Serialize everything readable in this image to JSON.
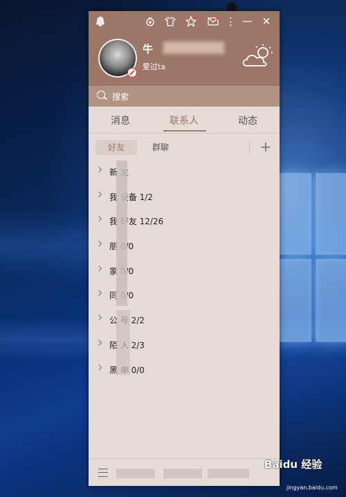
{
  "header": {
    "nickname_visible": "牛",
    "signature": "爱过ta"
  },
  "search": {
    "placeholder": "搜索"
  },
  "tabs": [
    {
      "label": "消息"
    },
    {
      "label": "联系人"
    },
    {
      "label": "动态"
    }
  ],
  "subtabs": {
    "friends": "好友",
    "groups": "群聊",
    "add": "+"
  },
  "groups": [
    {
      "label": "新 友"
    },
    {
      "label": "我 设备 1/2"
    },
    {
      "label": "我 好友 12/26"
    },
    {
      "label": "朋 0/0"
    },
    {
      "label": "家 0/0"
    },
    {
      "label": "同 0/0"
    },
    {
      "label": "公 号 2/2"
    },
    {
      "label": "陌 人 2/3"
    },
    {
      "label": "黑 单 0/0"
    }
  ],
  "watermark": {
    "text": "Baidu 经验",
    "sub": "jingyan.baidu.com"
  },
  "colors": {
    "theme": "#9c7768",
    "panel_bg": "#e6dcd7"
  }
}
